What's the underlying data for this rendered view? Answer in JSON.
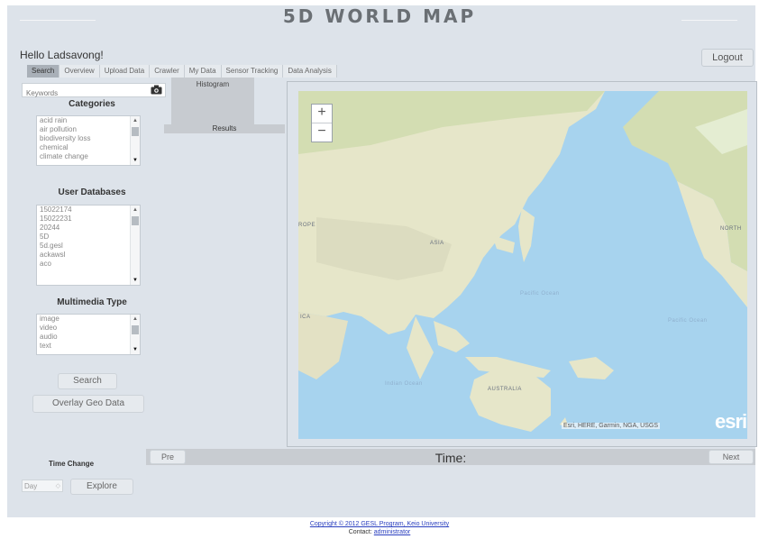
{
  "app": {
    "title": "5D WORLD MAP",
    "greeting": "Hello Ladsavong!",
    "logout_label": "Logout"
  },
  "tabs": [
    {
      "label": "Search",
      "active": true
    },
    {
      "label": "Overview"
    },
    {
      "label": "Upload Data"
    },
    {
      "label": "Crawler"
    },
    {
      "label": "My Data"
    },
    {
      "label": "Sensor Tracking"
    },
    {
      "label": "Data Analysis"
    }
  ],
  "search": {
    "keywords_placeholder": "Keywords",
    "categories": {
      "title": "Categories",
      "items": [
        "acid rain",
        "air pollution",
        "biodiversity loss",
        "chemical",
        "climate change"
      ]
    },
    "user_databases": {
      "title": "User Databases",
      "items": [
        "15022174",
        "15022231",
        "20244",
        "5D",
        "5d.gesl",
        "ackawsl",
        "aco"
      ]
    },
    "multimedia": {
      "title": "Multimedia Type",
      "items": [
        "image",
        "video",
        "audio",
        "text"
      ]
    },
    "search_label": "Search",
    "overlay_label": "Overlay Geo Data"
  },
  "panels": {
    "histogram_label": "Histogram",
    "results_label": "Results"
  },
  "map": {
    "zoom_in": "+",
    "zoom_out": "−",
    "attribution": "Esri, HERE, Garmin, NGA, USGS",
    "logo_text": "esri",
    "labels": {
      "asia": "ASIA",
      "australia": "AUSTRALIA",
      "pacific_ocean": "Pacific Ocean",
      "pacific_ocean_2": "Pacific Ocean",
      "indian_ocean": "Indian Ocean",
      "north": "NORTH",
      "rope": "ROPE",
      "ica": "ICA"
    }
  },
  "time": {
    "change_title": "Time Change",
    "unit_value": "Day",
    "explore_label": "Explore",
    "prev_label": "Pre",
    "time_label": "Time:",
    "next_label": "Next"
  },
  "footer": {
    "copyright": "Copyright © 2012  GESL Program, Keio University",
    "contact_prefix": "Contact:",
    "contact_link": "administrator"
  },
  "colors": {
    "frame_bg": "#dde3ea",
    "ocean": "#a7d3ee",
    "land": "#e6e6c9",
    "accent_link": "#2a3fbf"
  }
}
